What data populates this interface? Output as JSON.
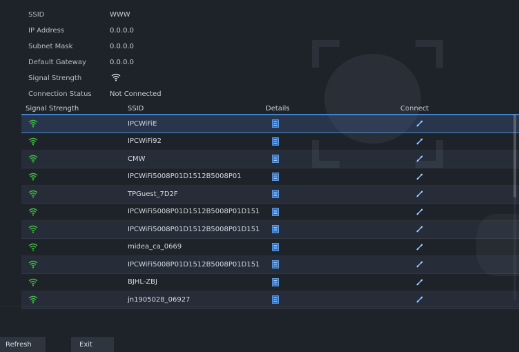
{
  "info": {
    "rows": [
      {
        "label": "SSID",
        "value": "WWW"
      },
      {
        "label": "IP Address",
        "value": "0.0.0.0"
      },
      {
        "label": "Subnet Mask",
        "value": "0.0.0.0"
      },
      {
        "label": "Default Gateway",
        "value": "0.0.0.0"
      },
      {
        "label": "Signal Strength",
        "value": ""
      },
      {
        "label": "Connection Status",
        "value": "Not Connected"
      }
    ]
  },
  "table": {
    "headers": {
      "signal": "Signal Strength",
      "ssid": "SSID",
      "details": "Details",
      "connect": "Connect"
    },
    "rows": [
      {
        "ssid": "IPCWiFiE",
        "selected": true
      },
      {
        "ssid": "IPCWiFi92"
      },
      {
        "ssid": "CMW"
      },
      {
        "ssid": "IPCWiFi5008P01D1512B5008P01"
      },
      {
        "ssid": "TPGuest_7D2F"
      },
      {
        "ssid": "IPCWiFi5008P01D1512B5008P01D151"
      },
      {
        "ssid": "IPCWiFi5008P01D1512B5008P01D151"
      },
      {
        "ssid": "midea_ca_0669"
      },
      {
        "ssid": "IPCWiFi5008P01D1512B5008P01D151"
      },
      {
        "ssid": "BJHL-ZBJ"
      },
      {
        "ssid": "jn1905028_06927"
      }
    ]
  },
  "buttons": {
    "refresh": "Refresh",
    "exit": "Exit"
  },
  "colors": {
    "background": "#1e2229",
    "accent": "#3c7ec5",
    "wifi_green": "#3fbf3f",
    "details_blue": "#4a90e2"
  },
  "icons": {
    "signal": "wifi-icon",
    "details": "details-icon",
    "connect": "connect-icon"
  }
}
